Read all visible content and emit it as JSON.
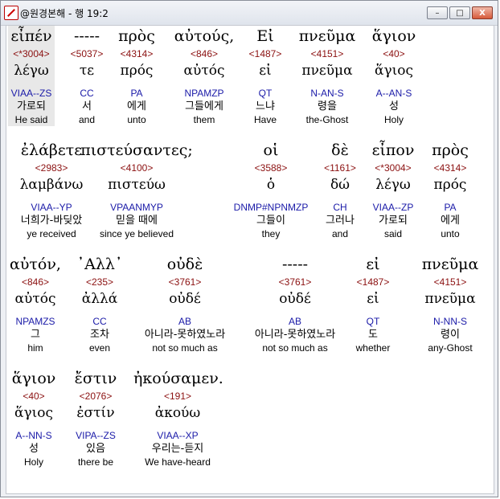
{
  "window": {
    "title": "@원경본해 - 행 19:2",
    "buttons": {
      "minimize": "–",
      "maximize": "□",
      "close": "X"
    }
  },
  "rows": [
    {
      "words": [
        {
          "greek": "εἶπέν",
          "strongs": "<*3004>",
          "lemma": "λέγω",
          "parsing": "VIAA--ZS",
          "korean": "가로되",
          "english": "He said"
        },
        {
          "greek": "-----",
          "strongs": "<5037>",
          "lemma": "τε",
          "parsing": "CC",
          "korean": "서",
          "english": "and"
        },
        {
          "greek": "πρὸς",
          "strongs": "<4314>",
          "lemma": "πρός",
          "parsing": "PA",
          "korean": "에게",
          "english": "unto"
        },
        {
          "greek": "αὐτούς,",
          "strongs": "<846>",
          "lemma": "αὐτός",
          "parsing": "NPAMZP",
          "korean": "그들에게",
          "english": "them"
        },
        {
          "greek": "Εἰ",
          "strongs": "<1487>",
          "lemma": "εἰ",
          "parsing": "QT",
          "korean": "느냐",
          "english": "Have"
        },
        {
          "greek": "πνεῦμα",
          "strongs": "<4151>",
          "lemma": "πνεῦμα",
          "parsing": "N-AN-S",
          "korean": "령을",
          "english": "the-Ghost"
        },
        {
          "greek": "ἅγιον",
          "strongs": "<40>",
          "lemma": "ἅγιος",
          "parsing": "A--AN-S",
          "korean": "성",
          "english": "Holy"
        }
      ]
    },
    {
      "words": [
        {
          "greek": "ἐλάβετε",
          "strongs": "<2983>",
          "lemma": "λαμβάνω",
          "parsing": "VIAA--YP",
          "korean": "너희가-바딪았",
          "english": "ye received"
        },
        {
          "greek": "πιστεύσαντες;",
          "strongs": "<4100>",
          "lemma": "πιστεύω",
          "parsing": "VPAANMYP",
          "korean": "믿을 때에",
          "english": "since ye believed"
        },
        {
          "greek": "οἱ",
          "strongs": "<3588>",
          "lemma": "ὁ",
          "parsing": "DNMP#NPNMZP",
          "korean": "그들이",
          "english": "they"
        },
        {
          "greek": "δὲ",
          "strongs": "<1161>",
          "lemma": "δώ",
          "parsing": "CH",
          "korean": "그러나",
          "english": "and"
        },
        {
          "greek": "εἶπον",
          "strongs": "<*3004>",
          "lemma": "λέγω",
          "parsing": "VIAA--ZP",
          "korean": "가로되",
          "english": "said"
        },
        {
          "greek": "πρὸς",
          "strongs": "<4314>",
          "lemma": "πρός",
          "parsing": "PA",
          "korean": "에게",
          "english": "unto"
        }
      ]
    },
    {
      "words": [
        {
          "greek": "αὐτόν,",
          "strongs": "<846>",
          "lemma": "αὐτός",
          "parsing": "NPAMZS",
          "korean": "그",
          "english": "him"
        },
        {
          "greek": "᾽Αλλ᾽",
          "strongs": "<235>",
          "lemma": "ἀλλά",
          "parsing": "CC",
          "korean": "조차",
          "english": "even"
        },
        {
          "greek": "οὐδὲ",
          "strongs": "<3761>",
          "lemma": "οὐδέ",
          "parsing": "AB",
          "korean": "아니라-못하였노라",
          "english": "not so much as"
        },
        {
          "greek": "-----",
          "strongs": "<3761>",
          "lemma": "οὐδέ",
          "parsing": "AB",
          "korean": "아니라-못하였노라",
          "english": "not so much as"
        },
        {
          "greek": "εἰ",
          "strongs": "<1487>",
          "lemma": "εἰ",
          "parsing": "QT",
          "korean": "도",
          "english": "whether"
        },
        {
          "greek": "πνεῦμα",
          "strongs": "<4151>",
          "lemma": "πνεῦμα",
          "parsing": "N-NN-S",
          "korean": "령이",
          "english": "any-Ghost"
        }
      ]
    },
    {
      "words": [
        {
          "greek": "ἅγιον",
          "strongs": "<40>",
          "lemma": "ἅγιος",
          "parsing": "A--NN-S",
          "korean": "성",
          "english": "Holy"
        },
        {
          "greek": "ἔστιν",
          "strongs": "<2076>",
          "lemma": "ἐστίν",
          "parsing": "VIPA--ZS",
          "korean": "있음",
          "english": "there be"
        },
        {
          "greek": "ἠκούσαμεν.",
          "strongs": "<191>",
          "lemma": "ἀκούω",
          "parsing": "VIAA--XP",
          "korean": "우리는-듣지",
          "english": "We have-heard"
        }
      ]
    }
  ]
}
